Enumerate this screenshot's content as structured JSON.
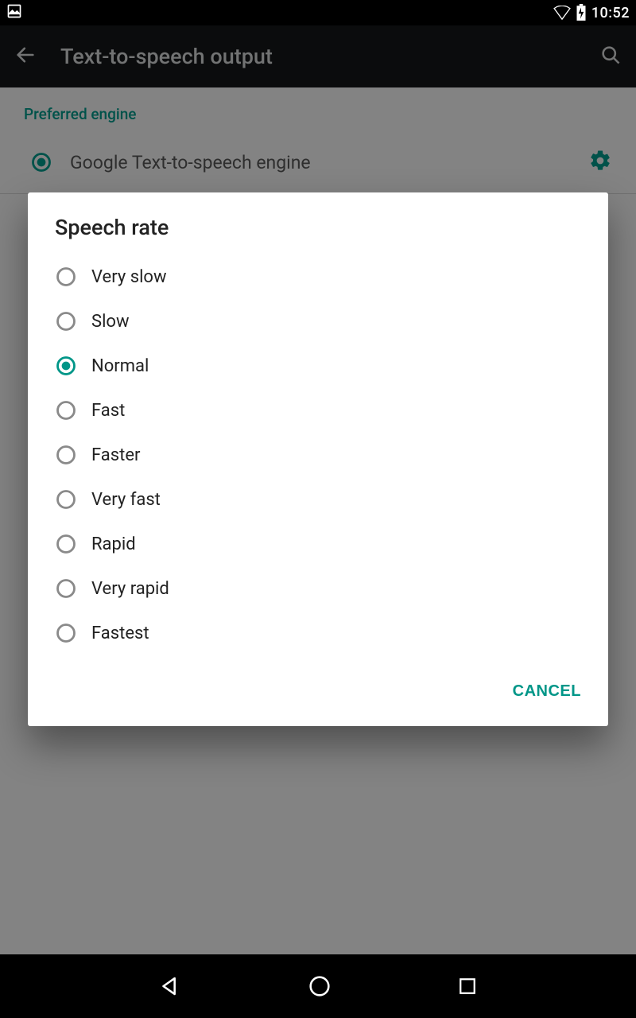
{
  "status": {
    "time": "10:52"
  },
  "appbar": {
    "title": "Text-to-speech output"
  },
  "background": {
    "section_label": "Preferred engine",
    "engine_label": "Google Text-to-speech engine"
  },
  "dialog": {
    "title": "Speech rate",
    "selected_index": 2,
    "options": [
      {
        "label": "Very slow"
      },
      {
        "label": "Slow"
      },
      {
        "label": "Normal"
      },
      {
        "label": "Fast"
      },
      {
        "label": "Faster"
      },
      {
        "label": "Very fast"
      },
      {
        "label": "Rapid"
      },
      {
        "label": "Very rapid"
      },
      {
        "label": "Fastest"
      }
    ],
    "cancel_label": "CANCEL"
  },
  "colors": {
    "accent": "#009688"
  }
}
